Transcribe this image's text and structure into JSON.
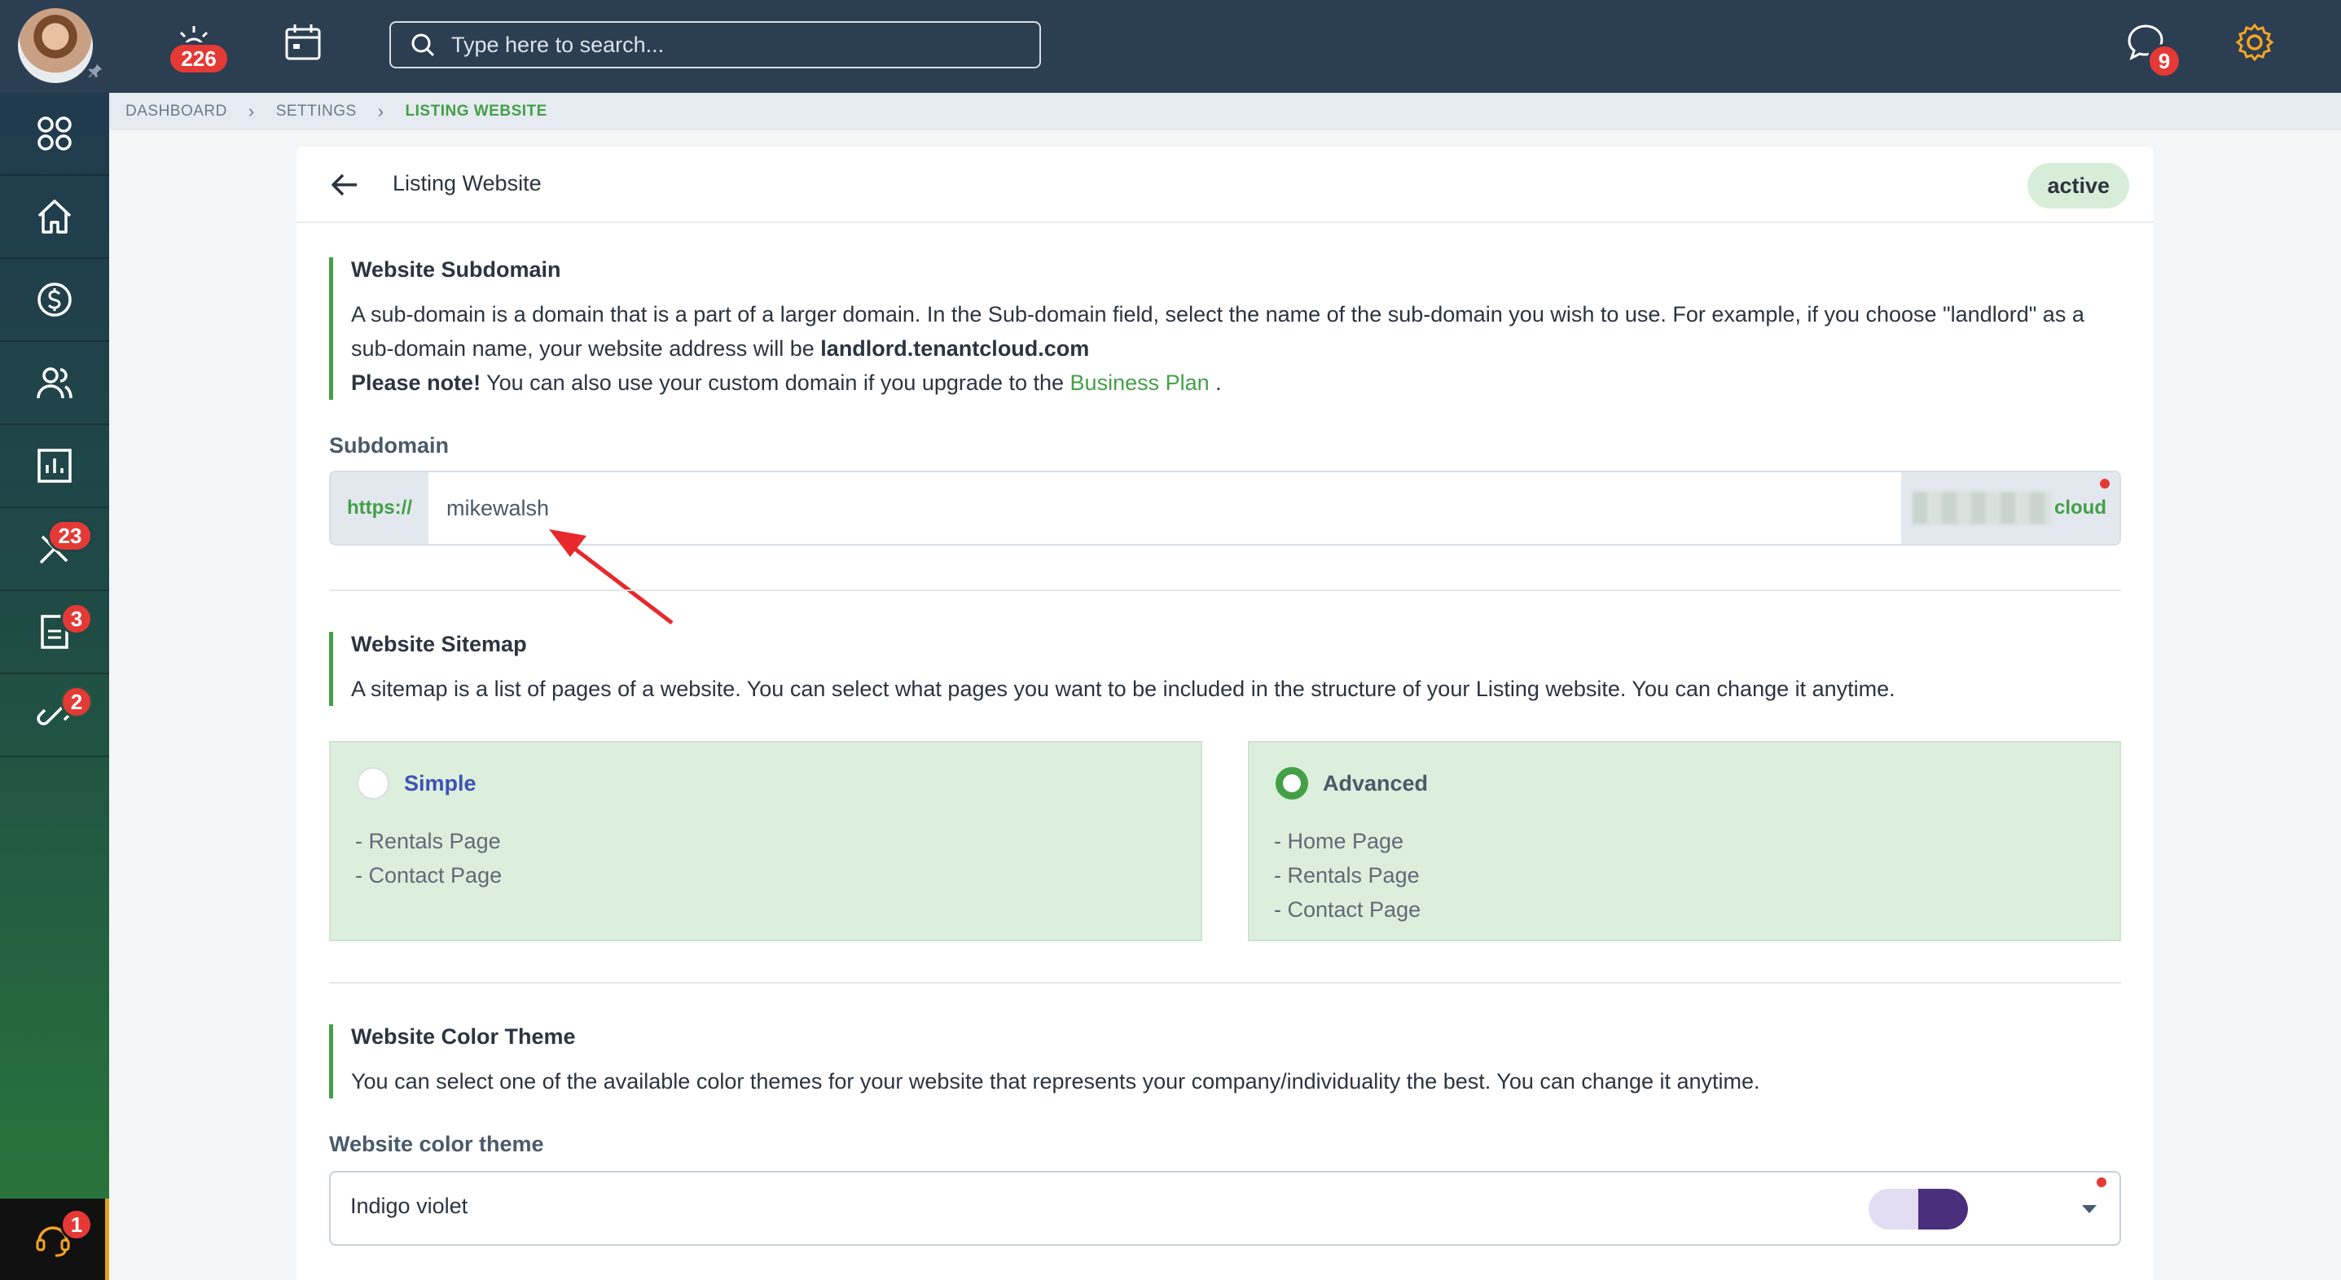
{
  "topbar": {
    "notifications_count": "226",
    "search_placeholder": "Type here to search...",
    "messages_count": "9"
  },
  "sidebar": {
    "badges": {
      "maintenance": "23",
      "documents": "3",
      "integrations": "2",
      "support": "1"
    }
  },
  "breadcrumb": {
    "items": [
      "DASHBOARD",
      "SETTINGS",
      "LISTING WEBSITE"
    ]
  },
  "page": {
    "title": "Listing Website",
    "status": "active"
  },
  "subdomain_section": {
    "title": "Website Subdomain",
    "text_1": "A sub-domain is a domain that is a part of a larger domain. In the Sub-domain field, select the name of the sub-domain you wish to use. For example, if you choose \"landlord\" as a sub-domain name, your website address will be",
    "example_domain": "landlord.tenantcloud.com",
    "note_bold": "Please note!",
    "note_text": "You can also use your custom domain if you upgrade to the",
    "plan_link": "Business Plan",
    "note_end": "."
  },
  "subdomain_field": {
    "label": "Subdomain",
    "prefix": "https://",
    "value": "mikewalsh",
    "suffix": "cloud"
  },
  "sitemap_section": {
    "title": "Website Sitemap",
    "text": "A sitemap is a list of pages of a website. You can select what pages you want to be included in the structure of your Listing website. You can change it anytime.",
    "options": [
      {
        "title": "Simple",
        "selected": false,
        "pages": [
          "- Rentals Page",
          "- Contact Page"
        ]
      },
      {
        "title": "Advanced",
        "selected": true,
        "pages": [
          "- Home Page",
          "- Rentals Page",
          "- Contact Page"
        ]
      }
    ]
  },
  "theme_section": {
    "title": "Website Color Theme",
    "text": "You can select one of the available color themes for your website that represents your company/individuality the best. You can change it anytime.",
    "field_label": "Website color theme",
    "selected": "Indigo violet",
    "swatch_colors": [
      "#e4dcf2",
      "#4a2f7d"
    ]
  },
  "colors": {
    "accent": "#43a047",
    "topbar": "#2c3e52",
    "badge": "#e53935",
    "simple_title": "#3f51b5"
  }
}
